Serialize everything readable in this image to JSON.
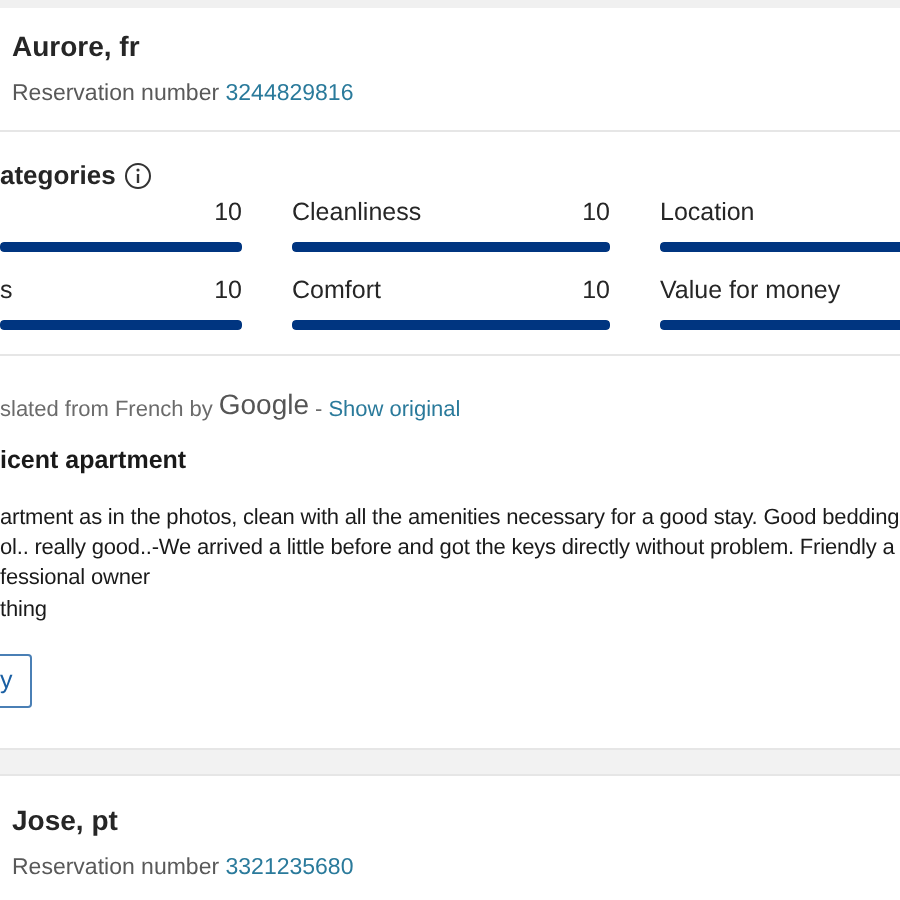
{
  "reviews": [
    {
      "name": "Aurore, fr",
      "reservation_label": "Reservation number",
      "reservation_number": "3244829816"
    }
  ],
  "categories": {
    "title": "ategories",
    "items": [
      {
        "score": "10",
        "level": 1
      },
      {
        "label": "Cleanliness",
        "score": "10",
        "level": 1
      },
      {
        "label": "Location",
        "level": 1
      },
      {
        "label": "s",
        "score": "10",
        "level": 1
      },
      {
        "label": "Comfort",
        "score": "10",
        "level": 1
      },
      {
        "label": "Value for money",
        "level": 1
      }
    ]
  },
  "translation": {
    "text": "slated from French by",
    "provider": "Google",
    "separator": "-",
    "link": "Show original"
  },
  "review_title": "icent apartment",
  "review_lines": [
    "artment as in the photos, clean with all the amenities necessary for a good stay. Good bedding",
    "ol.. really good..-We arrived a little before and got the keys directly without problem. Friendly a",
    "fessional owner",
    "thing"
  ],
  "reply_button": "y",
  "next_review": {
    "name": "Jose, pt",
    "reservation_label": "Reservation number",
    "reservation_number": "3321235680"
  }
}
